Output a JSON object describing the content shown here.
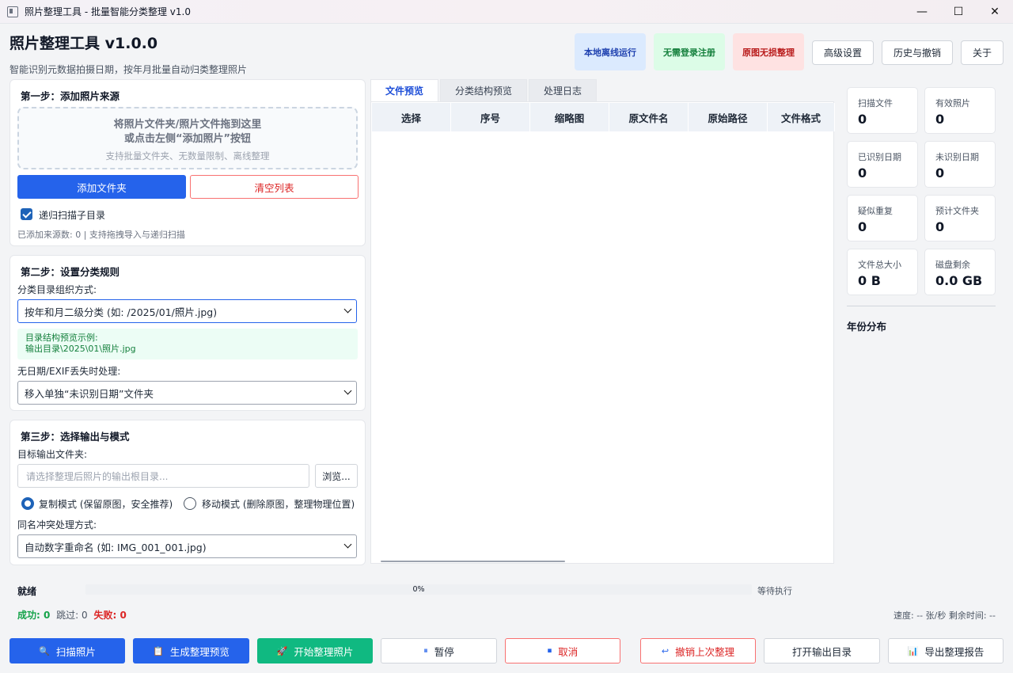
{
  "window": {
    "title": "照片整理工具 - 批量智能分类整理 v1.0",
    "minimize": "—",
    "maximize": "☐",
    "close": "✕"
  },
  "header": {
    "title": "照片整理工具 v1.0.0",
    "subtitle": "智能识别元数据拍摄日期，按年月批量自动归类整理照片",
    "badges": [
      "本地离线运行",
      "无需登录注册",
      "原图无损整理"
    ],
    "buttons": [
      "高级设置",
      "历史与撤销",
      "关于"
    ]
  },
  "step1": {
    "title": "第一步：添加照片来源",
    "drop_line1": "将照片文件夹/照片文件拖到这里",
    "drop_line2": "或点击左侧“添加照片”按钮",
    "drop_hint": "支持批量文件夹、无数量限制、离线整理",
    "add_folder": "添加文件夹",
    "clear_list": "清空列表",
    "recursive_label": "递归扫描子目录",
    "recursive_checked": true,
    "source_note": "已添加来源数: 0 | 支持拖拽导入与递归扫描"
  },
  "step2": {
    "title": "第二步：设置分类规则",
    "org_label": "分类目录组织方式:",
    "org_value": "按年和月二级分类 (如: /2025/01/照片.jpg)",
    "preview_line1": "目录结构预览示例:",
    "preview_line2": "输出目录\\2025\\01\\照片.jpg",
    "nodate_label": "无日期/EXIF丢失时处理:",
    "nodate_value": "移入单独“未识别日期”文件夹"
  },
  "step3": {
    "title": "第三步：选择输出与模式",
    "target_label": "目标输出文件夹:",
    "target_placeholder": "请选择整理后照片的输出根目录...",
    "browse": "浏览...",
    "copy_mode": "复制模式 (保留原图，安全推荐)",
    "move_mode": "移动模式 (删除原图，整理物理位置)",
    "selected_mode": "copy",
    "conflict_label": "同名冲突处理方式:",
    "conflict_value": "自动数字重命名 (如: IMG_001_001.jpg)"
  },
  "tabs": [
    "文件预览",
    "分类结构预览",
    "处理日志"
  ],
  "table": {
    "columns": [
      "选择",
      "序号",
      "缩略图",
      "原文件名",
      "原始路径",
      "文件格式"
    ],
    "rows": []
  },
  "stats": [
    {
      "label": "扫描文件",
      "value": "0"
    },
    {
      "label": "有效照片",
      "value": "0"
    },
    {
      "label": "已识别日期",
      "value": "0"
    },
    {
      "label": "未识别日期",
      "value": "0"
    },
    {
      "label": "疑似重复",
      "value": "0"
    },
    {
      "label": "预计文件夹",
      "value": "0"
    },
    {
      "label": "文件总大小",
      "value": "0 B"
    },
    {
      "label": "磁盘剩余",
      "value": "0.0 GB"
    }
  ],
  "year_distribution_title": "年份分布",
  "progress": {
    "status": "就绪",
    "percent": 0,
    "percent_text": "0%",
    "state_text": "等待执行",
    "success_text": "成功: 0",
    "skip_text": "跳过: 0",
    "fail_text": "失败: 0",
    "speed_text": "速度: -- 张/秒  剩余时间: --"
  },
  "actions": [
    {
      "label": "扫描照片",
      "icon": "🔍"
    },
    {
      "label": "生成整理预览",
      "icon": "📋"
    },
    {
      "label": "开始整理照片",
      "icon": "🚀"
    },
    {
      "label": "暂停",
      "icon": "⏸"
    },
    {
      "label": "取消",
      "icon": "⏹"
    },
    {
      "label": "撤销上次整理",
      "icon": "↩"
    },
    {
      "label": "打开输出目录",
      "icon": ""
    },
    {
      "label": "导出整理报告",
      "icon": "📊"
    }
  ],
  "colors": {
    "primary": "#2563eb",
    "success": "#10b981",
    "danger": "#dc2626"
  }
}
